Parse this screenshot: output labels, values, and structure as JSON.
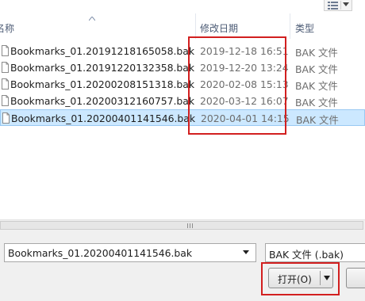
{
  "header": {
    "name_label": "名称",
    "date_label": "修改日期",
    "type_label": "类型"
  },
  "files": [
    {
      "name": "Bookmarks_01.20191218165058.bak",
      "date": "2019-12-18 16:51",
      "type": "BAK 文件"
    },
    {
      "name": "Bookmarks_01.20191220132358.bak",
      "date": "2019-12-20 13:24",
      "type": "BAK 文件"
    },
    {
      "name": "Bookmarks_01.20200208151318.bak",
      "date": "2020-02-08 15:13",
      "type": "BAK 文件"
    },
    {
      "name": "Bookmarks_01.20200312160757.bak",
      "date": "2020-03-12 16:07",
      "type": "BAK 文件"
    },
    {
      "name": "Bookmarks_01.20200401141546.bak",
      "date": "2020-04-01 14:15",
      "type": "BAK 文件"
    }
  ],
  "selected_index": 4,
  "filename": {
    "value": "Bookmarks_01.20200401141546.bak"
  },
  "filetype": {
    "value": "BAK 文件 (.bak)"
  },
  "buttons": {
    "open_label": "打开(O)"
  },
  "colors": {
    "highlight": "#d21f1f",
    "selection": "#cce8ff"
  },
  "icons": {
    "view_toggle": "details-view-icon",
    "file": "file-icon"
  }
}
